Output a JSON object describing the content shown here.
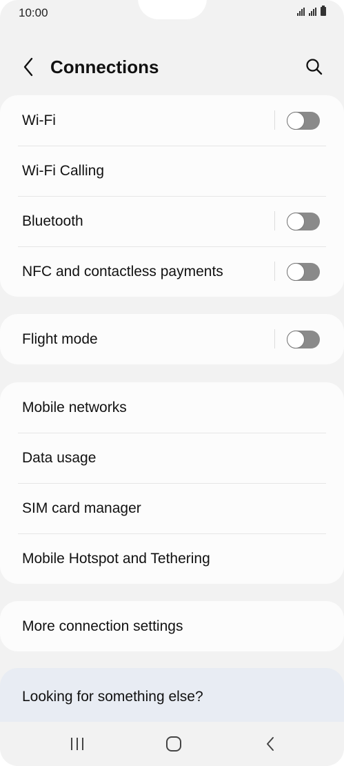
{
  "status_bar": {
    "time": "10:00",
    "icons": [
      "signal-icon",
      "signal-icon",
      "battery-icon"
    ]
  },
  "header": {
    "title": "Connections",
    "back_icon": "chevron-left-icon",
    "search_icon": "search-icon"
  },
  "groups": [
    {
      "items": [
        {
          "label": "Wi-Fi",
          "toggle": true,
          "on": false
        },
        {
          "label": "Wi-Fi Calling",
          "toggle": false
        },
        {
          "label": "Bluetooth",
          "toggle": true,
          "on": false
        },
        {
          "label": "NFC and contactless payments",
          "toggle": true,
          "on": false
        }
      ]
    },
    {
      "items": [
        {
          "label": "Flight mode",
          "toggle": true,
          "on": false
        }
      ]
    },
    {
      "items": [
        {
          "label": "Mobile networks",
          "toggle": false
        },
        {
          "label": "Data usage",
          "toggle": false
        },
        {
          "label": "SIM card manager",
          "toggle": false
        },
        {
          "label": "Mobile Hotspot and Tethering",
          "toggle": false
        }
      ]
    },
    {
      "items": [
        {
          "label": "More connection settings",
          "toggle": false
        }
      ]
    }
  ],
  "suggestion": {
    "label": "Looking for something else?"
  },
  "nav_bar": {
    "buttons": [
      "recent-apps-icon",
      "home-icon",
      "back-icon"
    ]
  },
  "colors": {
    "background": "#f2f2f2",
    "card": "#fcfcfc",
    "suggestion_card": "#e8ecf3",
    "toggle_off": "#8a8a8a"
  }
}
